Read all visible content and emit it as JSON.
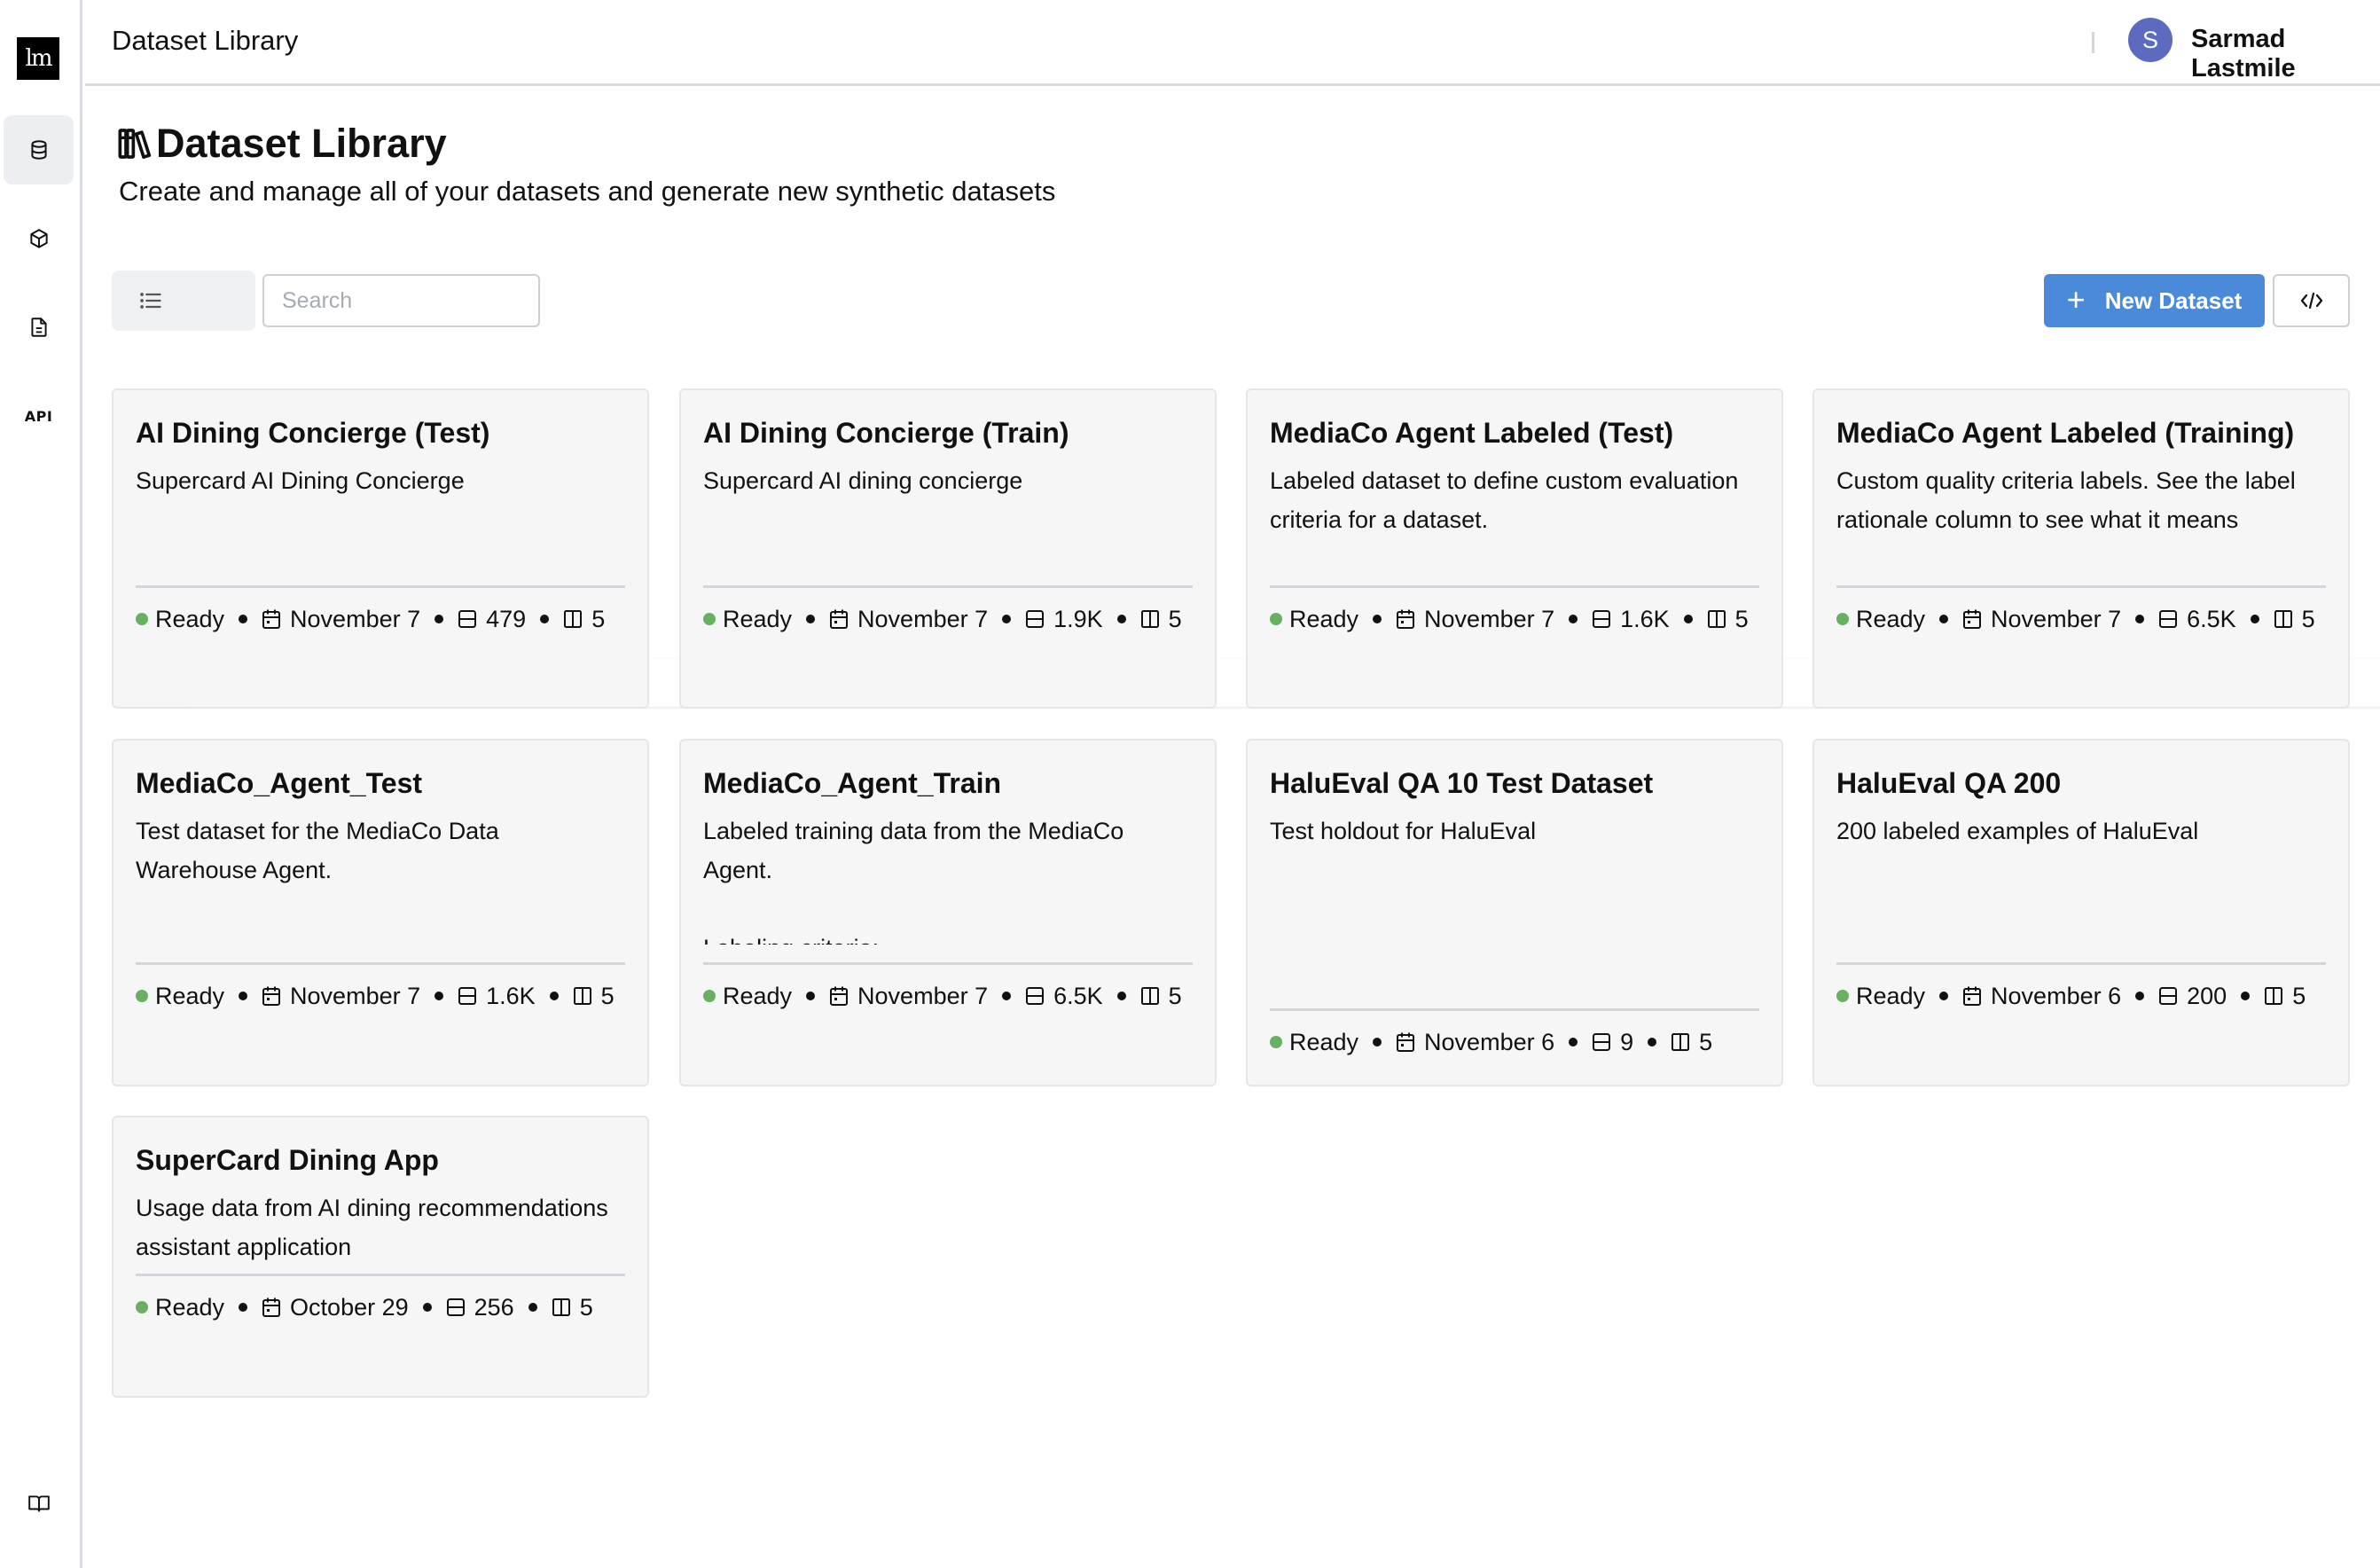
{
  "app": {
    "logo_text": "lm"
  },
  "header": {
    "title": "Dataset Library",
    "user": {
      "avatar_initial": "S",
      "name": "Sarmad Lastmile",
      "avatar_color": "#5c6bc0"
    }
  },
  "sidebar": {
    "items": [
      {
        "name": "datasets",
        "icon": "database-icon",
        "active": true
      },
      {
        "name": "models",
        "icon": "cube-icon",
        "active": false
      },
      {
        "name": "documents",
        "icon": "file-text-icon",
        "active": false
      },
      {
        "name": "api",
        "icon": "api-icon",
        "label": "API",
        "active": false
      }
    ],
    "bottom_item": {
      "name": "docs",
      "icon": "book-open-icon"
    }
  },
  "page": {
    "title": "Dataset Library",
    "title_icon": "library-icon",
    "subtitle": "Create and manage all of your datasets and generate new synthetic datasets"
  },
  "toolbar": {
    "view_modes": [
      {
        "name": "list",
        "icon": "list-icon",
        "selected": false
      },
      {
        "name": "grid",
        "icon": "grid-icon",
        "selected": true
      }
    ],
    "search": {
      "value": "",
      "placeholder": "Search"
    },
    "new_dataset_label": "New Dataset",
    "new_dataset_icon": "plus-icon",
    "code_icon": "code-icon",
    "accent_color": "#4a8ad9"
  },
  "status_color": "#68b161",
  "datasets": [
    {
      "title": "AI Dining Concierge (Test)",
      "description": "Supercard AI Dining Concierge",
      "status": "Ready",
      "date": "November 7",
      "rows": "479",
      "columns": "5"
    },
    {
      "title": "AI Dining Concierge (Train)",
      "description": "Supercard AI dining concierge",
      "status": "Ready",
      "date": "November 7",
      "rows": "1.9K",
      "columns": "5"
    },
    {
      "title": "MediaCo Agent Labeled (Test)",
      "description": "Labeled dataset to define custom evaluation criteria for a dataset.",
      "status": "Ready",
      "date": "November 7",
      "rows": "1.6K",
      "columns": "5"
    },
    {
      "title": "MediaCo Agent Labeled (Training)",
      "description": "Custom quality criteria labels. See the label rationale column to see what it means",
      "status": "Ready",
      "date": "November 7",
      "rows": "6.5K",
      "columns": "5"
    },
    {
      "title": "MediaCo_Agent_Test",
      "description": "Test dataset for the MediaCo Data Warehouse Agent.",
      "status": "Ready",
      "date": "November 7",
      "rows": "1.6K",
      "columns": "5"
    },
    {
      "title": "MediaCo_Agent_Train",
      "description": "Labeled training data from the MediaCo Agent.\n\nLabeling criteria:",
      "status": "Ready",
      "date": "November 7",
      "rows": "6.5K",
      "columns": "5"
    },
    {
      "title": "HaluEval QA 10 Test Dataset",
      "description": "Test holdout for HaluEval",
      "status": "Ready",
      "date": "November 6",
      "rows": "9",
      "columns": "5"
    },
    {
      "title": "HaluEval QA 200",
      "description": "200 labeled examples of HaluEval",
      "status": "Ready",
      "date": "November 6",
      "rows": "200",
      "columns": "5"
    },
    {
      "title": "SuperCard Dining App",
      "description": "Usage data from AI dining recommendations assistant application",
      "status": "Ready",
      "date": "October 29",
      "rows": "256",
      "columns": "5"
    }
  ]
}
